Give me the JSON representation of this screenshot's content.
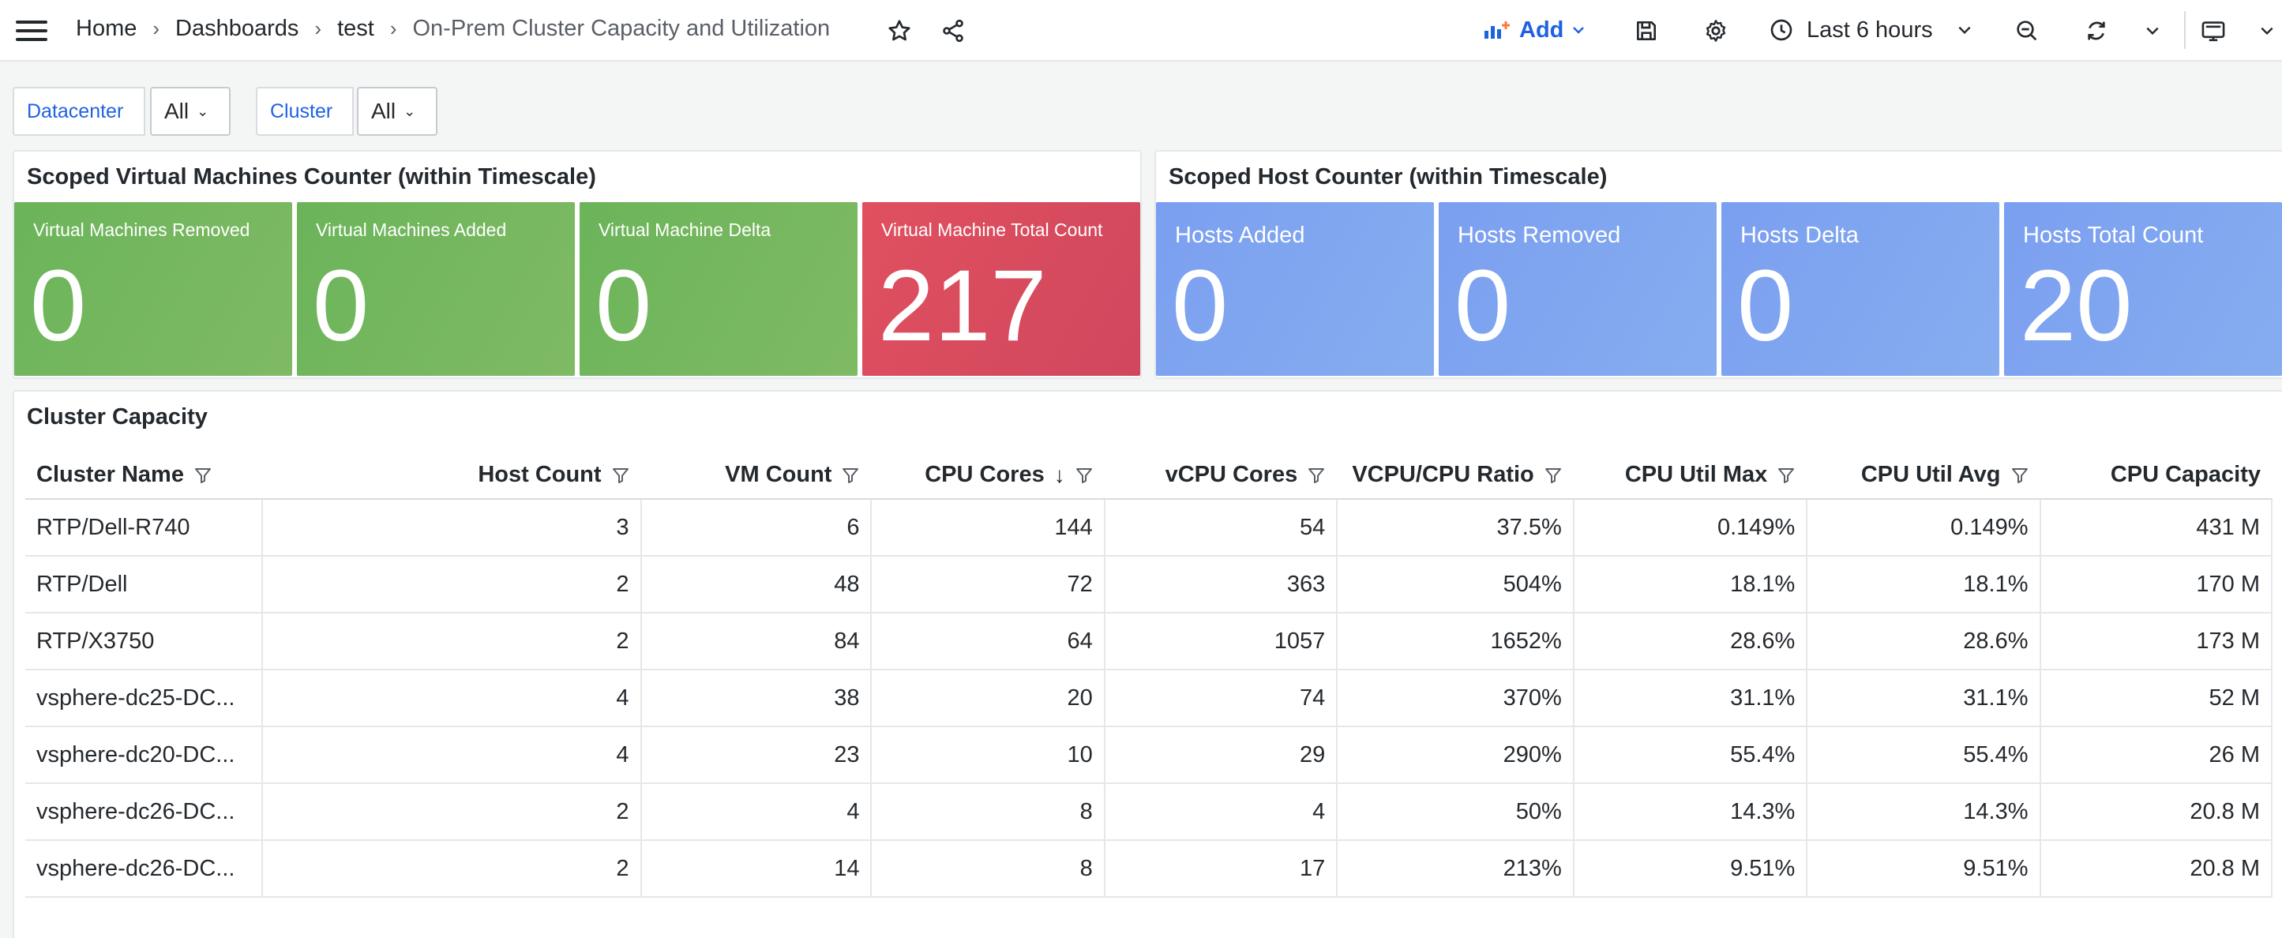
{
  "breadcrumb": {
    "items": [
      "Home",
      "Dashboards",
      "test"
    ],
    "current": "On-Prem Cluster Capacity and Utilization",
    "separator": "›"
  },
  "toolbar": {
    "add_label": "Add",
    "time_range": "Last 6 hours"
  },
  "variables": [
    {
      "label": "Datacenter",
      "value": "All"
    },
    {
      "label": "Cluster",
      "value": "All"
    }
  ],
  "vm_panel": {
    "title": "Scoped Virtual Machines Counter (within Timescale)",
    "stats": [
      {
        "label": "Virtual Machines Removed",
        "value": "0",
        "color": "#73b35d"
      },
      {
        "label": "Virtual Machines Added",
        "value": "0",
        "color": "#73b35d"
      },
      {
        "label": "Virtual Machine Delta",
        "value": "0",
        "color": "#73b35d"
      },
      {
        "label": "Virtual Machine Total Count",
        "value": "217",
        "color": "#d94c5e"
      }
    ]
  },
  "host_panel": {
    "title": "Scoped Host Counter (within Timescale)",
    "stats": [
      {
        "label": "Hosts Added",
        "value": "0",
        "color": "#80a6f0"
      },
      {
        "label": "Hosts Removed",
        "value": "0",
        "color": "#80a6f0"
      },
      {
        "label": "Hosts Delta",
        "value": "0",
        "color": "#80a6f0"
      },
      {
        "label": "Hosts Total Count",
        "value": "20",
        "color": "#80a6f0"
      }
    ]
  },
  "capacity_panel": {
    "title": "Cluster Capacity",
    "columns": [
      "Cluster Name",
      "Host Count",
      "VM Count",
      "CPU Cores",
      "vCPU Cores",
      "VCPU/CPU Ratio",
      "CPU Util Max",
      "CPU Util Avg",
      "CPU Capacity"
    ],
    "sorted_column": "CPU Cores",
    "sort_direction": "descending",
    "rows": [
      [
        "RTP/Dell-R740",
        "3",
        "6",
        "144",
        "54",
        "37.5%",
        "0.149%",
        "0.149%",
        "431 M"
      ],
      [
        "RTP/Dell",
        "2",
        "48",
        "72",
        "363",
        "504%",
        "18.1%",
        "18.1%",
        "170 M"
      ],
      [
        "RTP/X3750",
        "2",
        "84",
        "64",
        "1057",
        "1652%",
        "28.6%",
        "28.6%",
        "173 M"
      ],
      [
        "vsphere-dc25-DC...",
        "4",
        "38",
        "20",
        "74",
        "370%",
        "31.1%",
        "31.1%",
        "52 M"
      ],
      [
        "vsphere-dc20-DC...",
        "4",
        "23",
        "10",
        "29",
        "290%",
        "55.4%",
        "55.4%",
        "26 M"
      ],
      [
        "vsphere-dc26-DC...",
        "2",
        "4",
        "8",
        "4",
        "50%",
        "14.3%",
        "14.3%",
        "20.8 M"
      ],
      [
        "vsphere-dc26-DC...",
        "2",
        "14",
        "8",
        "17",
        "213%",
        "9.51%",
        "9.51%",
        "20.8 M"
      ]
    ]
  }
}
